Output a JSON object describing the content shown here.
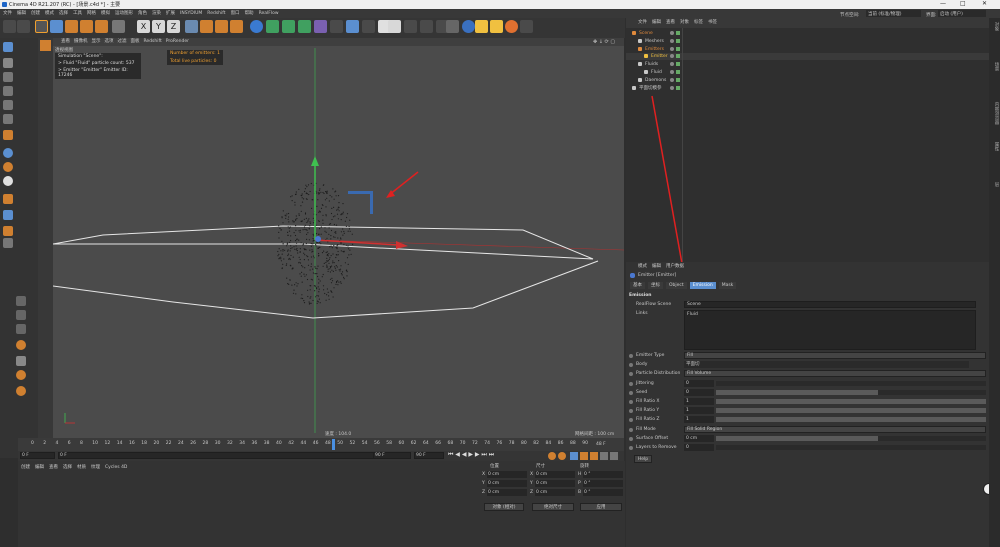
{
  "window": {
    "title": "Cinema 4D R21.207 (RC) - [场景.c4d *] - 主要",
    "controls": [
      "—",
      "□",
      "✕"
    ]
  },
  "menu": [
    "文件",
    "编辑",
    "创建",
    "模式",
    "选择",
    "工具",
    "网格",
    "模拟",
    "运动图形",
    "角色",
    "渲染",
    "扩展",
    "INSYDIUM",
    "Redshift",
    "窗口",
    "帮助",
    "RealFlow"
  ],
  "top_right": {
    "node_space_label": "节点空间:",
    "node_space_value": "当前 (标准/物理)",
    "layout_label": "界面:",
    "layout_value": "启动 (用户)"
  },
  "axis_buttons": [
    "X",
    "Y",
    "Z"
  ],
  "viewport_menu": [
    "查看",
    "摄像机",
    "显示",
    "选项",
    "过滤",
    "面板",
    "Redshift",
    "ProRender"
  ],
  "viewport_label": "透视视图",
  "hud_sim": {
    "line1": "Simulation \"Scene\":",
    "line2": "> Fluid \"Fluid\" particle count: 537",
    "line3": "> Emitter \"Emitter\" Emitter ID: 17246"
  },
  "hud_emitters": {
    "line1": "Number of emitters: 1",
    "line2": "Total live particles: 0"
  },
  "viewport_speed": "速度 : 104.0",
  "viewport_grid": "网格间距 : 100 cm",
  "timeline_ticks": [
    "0",
    "2",
    "4",
    "6",
    "8",
    "10",
    "12",
    "14",
    "16",
    "18",
    "20",
    "22",
    "24",
    "26",
    "28",
    "30",
    "32",
    "34",
    "36",
    "38",
    "40",
    "42",
    "44",
    "46",
    "48",
    "50",
    "52",
    "54",
    "56",
    "58",
    "60",
    "62",
    "64",
    "66",
    "68",
    "70",
    "72",
    "74",
    "76",
    "78",
    "80",
    "82",
    "84",
    "86",
    "88",
    "90"
  ],
  "timeline_current": "48 F",
  "timebar": {
    "start": "0 F",
    "field2": "0 F",
    "end": "90 F",
    "end2": "90 F"
  },
  "mat_menu": [
    "创建",
    "编辑",
    "查看",
    "选择",
    "材质",
    "纹理",
    "Cycles 4D"
  ],
  "coord": {
    "headers": [
      "位置",
      "尺寸",
      "旋转"
    ],
    "rows": [
      {
        "axis": "X",
        "pos": "0 cm",
        "saxis": "X",
        "size": "0 cm",
        "raxis": "H",
        "rot": "0 °"
      },
      {
        "axis": "Y",
        "pos": "0 cm",
        "saxis": "Y",
        "size": "0 cm",
        "raxis": "P",
        "rot": "0 °"
      },
      {
        "axis": "Z",
        "pos": "0 cm",
        "saxis": "Z",
        "size": "0 cm",
        "raxis": "B",
        "rot": "0 °"
      }
    ],
    "mode1": "对象 (相对)",
    "mode2": "绝对尺寸",
    "apply": "应用"
  },
  "obj_menu": [
    "文件",
    "编辑",
    "查看",
    "对象",
    "标签",
    "书签"
  ],
  "objects": [
    {
      "name": "Scene",
      "indent": 0,
      "color": "#e08a3c"
    },
    {
      "name": "Meshers",
      "indent": 1,
      "color": "#c8c8c8"
    },
    {
      "name": "Emitters",
      "indent": 1,
      "color": "#e08a3c"
    },
    {
      "name": "Emitter",
      "indent": 2,
      "color": "#f0c040"
    },
    {
      "name": "Fluids",
      "indent": 1,
      "color": "#c8c8c8"
    },
    {
      "name": "Fluid",
      "indent": 2,
      "color": "#c8c8c8"
    },
    {
      "name": "Daemons",
      "indent": 1,
      "color": "#c8c8c8"
    },
    {
      "name": "平面切模参",
      "indent": 0,
      "color": "#c8c8c8"
    }
  ],
  "attr_menu": [
    "模式",
    "编辑",
    "用户数据"
  ],
  "attr_title": "Emitter [Emitter]",
  "attr_tabs": [
    "基本",
    "坐标",
    "Object",
    "Emission",
    "Mask"
  ],
  "attr_section": "Emission",
  "attr_realflow_scene_label": "RealFlow Scene",
  "attr_realflow_scene_value": "Scene",
  "attr_links_label": "Links",
  "attr_links_value": "Fluid",
  "attr_rows": [
    {
      "label": "Emitter Type",
      "value": "Fill",
      "kind": "dropdown"
    },
    {
      "label": "Body",
      "value": "平面切",
      "kind": "link"
    },
    {
      "label": "Particle Distribution",
      "value": "Fill Volume",
      "kind": "dropdown"
    },
    {
      "label": "Jittering",
      "value": "0",
      "kind": "slider",
      "level": 0
    },
    {
      "label": "Seed",
      "value": "0",
      "kind": "slider",
      "level": 0.6
    },
    {
      "label": "Fill Ratio X",
      "value": "1",
      "kind": "slider",
      "level": 1
    },
    {
      "label": "Fill Ratio Y",
      "value": "1",
      "kind": "slider",
      "level": 1
    },
    {
      "label": "Fill Ratio Z",
      "value": "1",
      "kind": "slider",
      "level": 1
    },
    {
      "label": "Fill Mode",
      "value": "Fill Solid Region",
      "kind": "dropdown"
    },
    {
      "label": "Surface Offset",
      "value": "0 cm",
      "kind": "slider",
      "level": 0.6
    },
    {
      "label": "Layers to Remove",
      "value": "0",
      "kind": "slider",
      "level": 0
    }
  ],
  "help_button": "Help",
  "side_tabs": [
    "对象",
    "场景",
    "内容浏览器",
    "属性",
    "层"
  ],
  "colors": {
    "accent": "#5b8fd0",
    "annotation": "#e02020",
    "timeline_marker": "#4a90e2"
  }
}
